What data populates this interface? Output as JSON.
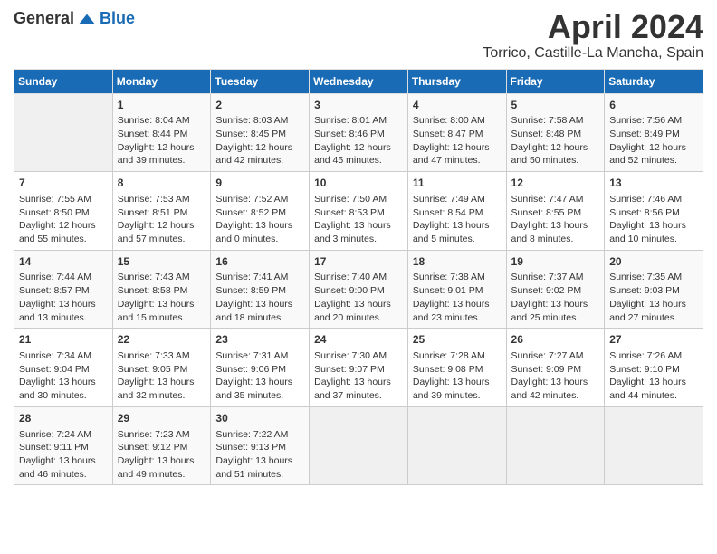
{
  "header": {
    "logo_general": "General",
    "logo_blue": "Blue",
    "title": "April 2024",
    "subtitle": "Torrico, Castille-La Mancha, Spain"
  },
  "calendar": {
    "days_of_week": [
      "Sunday",
      "Monday",
      "Tuesday",
      "Wednesday",
      "Thursday",
      "Friday",
      "Saturday"
    ],
    "weeks": [
      [
        {
          "day": "",
          "content": ""
        },
        {
          "day": "1",
          "content": "Sunrise: 8:04 AM\nSunset: 8:44 PM\nDaylight: 12 hours\nand 39 minutes."
        },
        {
          "day": "2",
          "content": "Sunrise: 8:03 AM\nSunset: 8:45 PM\nDaylight: 12 hours\nand 42 minutes."
        },
        {
          "day": "3",
          "content": "Sunrise: 8:01 AM\nSunset: 8:46 PM\nDaylight: 12 hours\nand 45 minutes."
        },
        {
          "day": "4",
          "content": "Sunrise: 8:00 AM\nSunset: 8:47 PM\nDaylight: 12 hours\nand 47 minutes."
        },
        {
          "day": "5",
          "content": "Sunrise: 7:58 AM\nSunset: 8:48 PM\nDaylight: 12 hours\nand 50 minutes."
        },
        {
          "day": "6",
          "content": "Sunrise: 7:56 AM\nSunset: 8:49 PM\nDaylight: 12 hours\nand 52 minutes."
        }
      ],
      [
        {
          "day": "7",
          "content": "Sunrise: 7:55 AM\nSunset: 8:50 PM\nDaylight: 12 hours\nand 55 minutes."
        },
        {
          "day": "8",
          "content": "Sunrise: 7:53 AM\nSunset: 8:51 PM\nDaylight: 12 hours\nand 57 minutes."
        },
        {
          "day": "9",
          "content": "Sunrise: 7:52 AM\nSunset: 8:52 PM\nDaylight: 13 hours\nand 0 minutes."
        },
        {
          "day": "10",
          "content": "Sunrise: 7:50 AM\nSunset: 8:53 PM\nDaylight: 13 hours\nand 3 minutes."
        },
        {
          "day": "11",
          "content": "Sunrise: 7:49 AM\nSunset: 8:54 PM\nDaylight: 13 hours\nand 5 minutes."
        },
        {
          "day": "12",
          "content": "Sunrise: 7:47 AM\nSunset: 8:55 PM\nDaylight: 13 hours\nand 8 minutes."
        },
        {
          "day": "13",
          "content": "Sunrise: 7:46 AM\nSunset: 8:56 PM\nDaylight: 13 hours\nand 10 minutes."
        }
      ],
      [
        {
          "day": "14",
          "content": "Sunrise: 7:44 AM\nSunset: 8:57 PM\nDaylight: 13 hours\nand 13 minutes."
        },
        {
          "day": "15",
          "content": "Sunrise: 7:43 AM\nSunset: 8:58 PM\nDaylight: 13 hours\nand 15 minutes."
        },
        {
          "day": "16",
          "content": "Sunrise: 7:41 AM\nSunset: 8:59 PM\nDaylight: 13 hours\nand 18 minutes."
        },
        {
          "day": "17",
          "content": "Sunrise: 7:40 AM\nSunset: 9:00 PM\nDaylight: 13 hours\nand 20 minutes."
        },
        {
          "day": "18",
          "content": "Sunrise: 7:38 AM\nSunset: 9:01 PM\nDaylight: 13 hours\nand 23 minutes."
        },
        {
          "day": "19",
          "content": "Sunrise: 7:37 AM\nSunset: 9:02 PM\nDaylight: 13 hours\nand 25 minutes."
        },
        {
          "day": "20",
          "content": "Sunrise: 7:35 AM\nSunset: 9:03 PM\nDaylight: 13 hours\nand 27 minutes."
        }
      ],
      [
        {
          "day": "21",
          "content": "Sunrise: 7:34 AM\nSunset: 9:04 PM\nDaylight: 13 hours\nand 30 minutes."
        },
        {
          "day": "22",
          "content": "Sunrise: 7:33 AM\nSunset: 9:05 PM\nDaylight: 13 hours\nand 32 minutes."
        },
        {
          "day": "23",
          "content": "Sunrise: 7:31 AM\nSunset: 9:06 PM\nDaylight: 13 hours\nand 35 minutes."
        },
        {
          "day": "24",
          "content": "Sunrise: 7:30 AM\nSunset: 9:07 PM\nDaylight: 13 hours\nand 37 minutes."
        },
        {
          "day": "25",
          "content": "Sunrise: 7:28 AM\nSunset: 9:08 PM\nDaylight: 13 hours\nand 39 minutes."
        },
        {
          "day": "26",
          "content": "Sunrise: 7:27 AM\nSunset: 9:09 PM\nDaylight: 13 hours\nand 42 minutes."
        },
        {
          "day": "27",
          "content": "Sunrise: 7:26 AM\nSunset: 9:10 PM\nDaylight: 13 hours\nand 44 minutes."
        }
      ],
      [
        {
          "day": "28",
          "content": "Sunrise: 7:24 AM\nSunset: 9:11 PM\nDaylight: 13 hours\nand 46 minutes."
        },
        {
          "day": "29",
          "content": "Sunrise: 7:23 AM\nSunset: 9:12 PM\nDaylight: 13 hours\nand 49 minutes."
        },
        {
          "day": "30",
          "content": "Sunrise: 7:22 AM\nSunset: 9:13 PM\nDaylight: 13 hours\nand 51 minutes."
        },
        {
          "day": "",
          "content": ""
        },
        {
          "day": "",
          "content": ""
        },
        {
          "day": "",
          "content": ""
        },
        {
          "day": "",
          "content": ""
        }
      ]
    ]
  }
}
